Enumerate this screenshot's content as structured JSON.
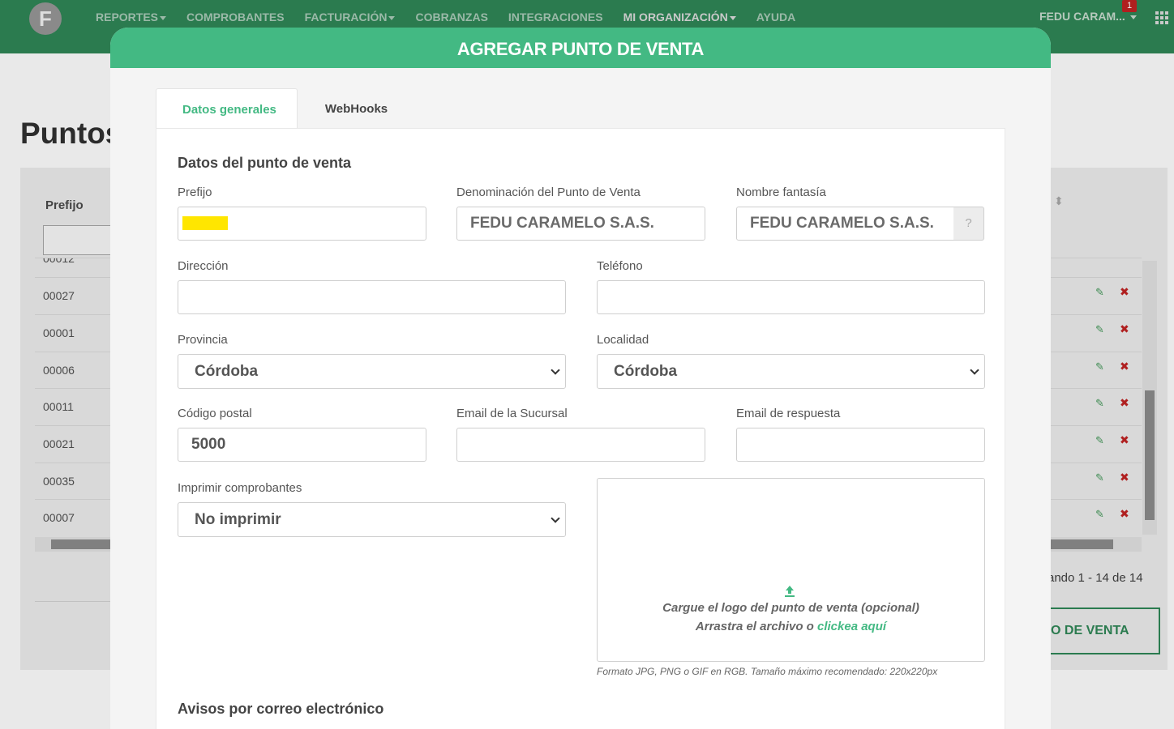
{
  "navbar": {
    "logo": "F",
    "menu": [
      {
        "label": "REPORTES",
        "dropdown": true
      },
      {
        "label": "COMPROBANTES",
        "dropdown": false
      },
      {
        "label": "FACTURACIÓN",
        "dropdown": true
      },
      {
        "label": "COBRANZAS",
        "dropdown": false
      },
      {
        "label": "INTEGRACIONES",
        "dropdown": false
      },
      {
        "label": "MI ORGANIZACIÓN",
        "dropdown": true
      },
      {
        "label": "AYUDA",
        "dropdown": false
      }
    ],
    "user": "FEDU CARAM...",
    "notification_count": "1"
  },
  "background_page": {
    "title": "Puntos",
    "column_prefix": "Prefijo",
    "rows": [
      "00012",
      "00027",
      "00001",
      "00006",
      "00011",
      "00021",
      "00035",
      "00007"
    ],
    "showing": "ando 1 - 14 de 14",
    "add_button": "O DE VENTA"
  },
  "modal": {
    "title": "AGREGAR PUNTO DE VENTA",
    "tabs": {
      "general": "Datos generales",
      "webhooks": "WebHooks"
    },
    "section_title": "Datos del punto de venta",
    "fields": {
      "prefijo": {
        "label": "Prefijo",
        "value": ""
      },
      "denominacion": {
        "label": "Denominación del Punto de Venta",
        "value": "FEDU CARAMELO S.A.S."
      },
      "nombre_fantasia": {
        "label": "Nombre fantasía",
        "value": "FEDU CARAMELO S.A.S.",
        "help": "?"
      },
      "direccion": {
        "label": "Dirección",
        "value": ""
      },
      "telefono": {
        "label": "Teléfono",
        "value": ""
      },
      "provincia": {
        "label": "Provincia",
        "value": "Córdoba"
      },
      "localidad": {
        "label": "Localidad",
        "value": "Córdoba"
      },
      "codigo_postal": {
        "label": "Código postal",
        "value": "5000"
      },
      "email_sucursal": {
        "label": "Email de la Sucursal",
        "value": ""
      },
      "email_respuesta": {
        "label": "Email de respuesta",
        "value": ""
      },
      "imprimir": {
        "label": "Imprimir comprobantes",
        "value": "No imprimir"
      }
    },
    "upload": {
      "line1": "Cargue el logo del punto de venta (opcional)",
      "line2_prefix": "Arrastra el archivo o ",
      "link": "clickea aquí",
      "hint": "Formato JPG, PNG o GIF en RGB. Tamaño máximo recomendado: 220x220px"
    },
    "section_avisos": "Avisos por correo electrónico"
  },
  "colors": {
    "nav": "#2b7b4f",
    "accent": "#43b983",
    "highlight": "#ffe600",
    "delete": "#b02020"
  }
}
